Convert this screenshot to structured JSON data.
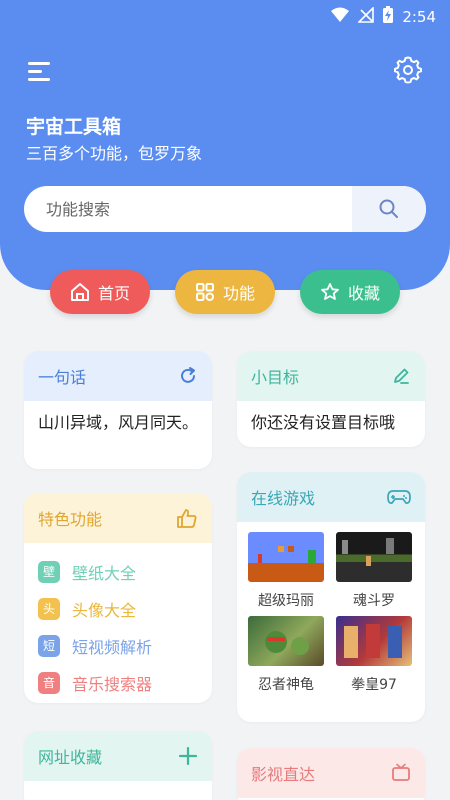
{
  "status": {
    "time": "2:54"
  },
  "header": {
    "title": "宇宙工具箱",
    "subtitle": "三百多个功能，包罗万象",
    "search_placeholder": "功能搜索"
  },
  "nav": {
    "home": "首页",
    "functions": "功能",
    "favorites": "收藏"
  },
  "quote_card": {
    "title": "一句话",
    "text": "山川异域，风月同天。"
  },
  "goal_card": {
    "title": "小目标",
    "text": "你还没有设置目标哦"
  },
  "features_card": {
    "title": "特色功能",
    "items": [
      {
        "badge": "壁",
        "label": "壁纸大全",
        "color": "#6fd0b6"
      },
      {
        "badge": "头",
        "label": "头像大全",
        "color": "#f2c14e"
      },
      {
        "badge": "短",
        "label": "短视频解析",
        "color": "#7aa3e8"
      },
      {
        "badge": "音",
        "label": "音乐搜索器",
        "color": "#f08080"
      }
    ]
  },
  "games_card": {
    "title": "在线游戏",
    "games": [
      {
        "name": "超级玛丽"
      },
      {
        "name": "魂斗罗"
      },
      {
        "name": "忍者神龟"
      },
      {
        "name": "拳皇97"
      }
    ]
  },
  "bookmarks_card": {
    "title": "网址收藏"
  },
  "movies_card": {
    "title": "影视直达"
  },
  "colors": {
    "header_blue": "#5b8df0",
    "home_red": "#ef5a5a",
    "func_yellow": "#ecb640",
    "fav_green": "#3cbf8e"
  }
}
